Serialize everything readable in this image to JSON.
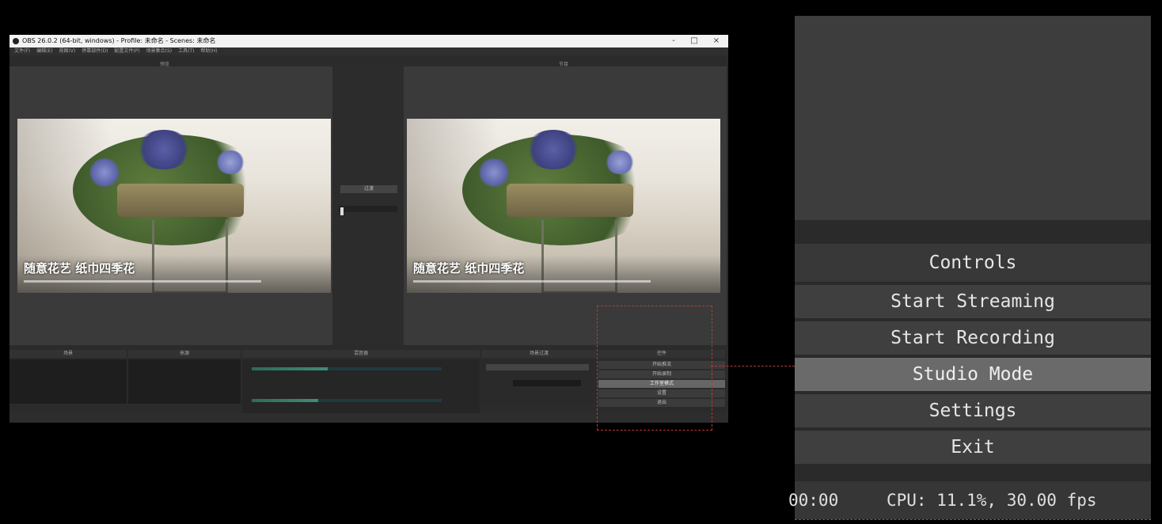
{
  "window": {
    "title": "OBS 26.0.2 (64-bit, windows) - Profile: 未命名 - Scenes: 未命名",
    "controls": [
      "-",
      "□",
      "×"
    ],
    "menu": [
      "文件(F)",
      "编辑(E)",
      "视图(V)",
      "停靠部件(D)",
      "配置文件(P)",
      "场景集合(S)",
      "工具(T)",
      "帮助(H)"
    ]
  },
  "preview_label": "预览",
  "program_label": "节目",
  "scene": {
    "title": "随意花艺 纸巾四季花",
    "transition_label": "过渡"
  },
  "docks": {
    "scenes": "场景",
    "sources": "来源",
    "mixer": "混音器",
    "transitions": "场景过渡",
    "controls": "控件"
  },
  "mini_controls": [
    "开始推流",
    "开始录制",
    "工作室模式",
    "设置",
    "退出"
  ],
  "zoom_panel": {
    "header": "Controls",
    "buttons": [
      "Start Streaming",
      "Start Recording",
      "Studio Mode",
      "Settings",
      "Exit"
    ],
    "active": "Studio Mode",
    "status_time": "00:00",
    "status_cpu": "CPU: 11.1%, 30.00 fps"
  },
  "colors": {
    "annotation": "#b43a3a",
    "active_button": "#6a6a6a"
  }
}
